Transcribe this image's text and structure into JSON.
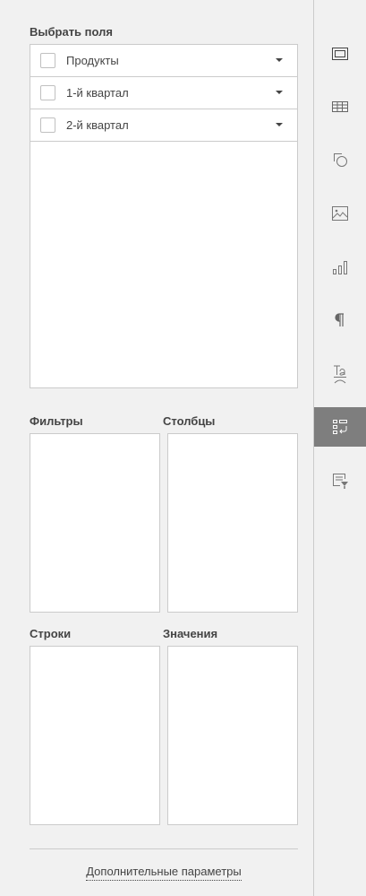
{
  "panel": {
    "select_fields_title": "Выбрать поля",
    "fields": [
      {
        "label": "Продукты",
        "checked": false
      },
      {
        "label": "1-й квартал",
        "checked": false
      },
      {
        "label": "2-й квартал",
        "checked": false
      }
    ],
    "filters_title": "Фильтры",
    "columns_title": "Столбцы",
    "rows_title": "Строки",
    "values_title": "Значения",
    "advanced_link": "Дополнительные параметры"
  },
  "rightbar": {
    "items": [
      {
        "icon": "slide-settings-icon",
        "active": false
      },
      {
        "icon": "table-settings-icon",
        "active": false
      },
      {
        "icon": "shape-settings-icon",
        "active": false
      },
      {
        "icon": "image-settings-icon",
        "active": false
      },
      {
        "icon": "chart-settings-icon",
        "active": false
      },
      {
        "icon": "paragraph-settings-icon",
        "active": false
      },
      {
        "icon": "text-art-settings-icon",
        "active": false
      },
      {
        "icon": "pivot-table-settings-icon",
        "active": true
      },
      {
        "icon": "signature-settings-icon",
        "active": false
      }
    ],
    "colors": {
      "active_bg": "#7e7e7e",
      "icon": "#444444",
      "active_icon": "#ffffff"
    }
  }
}
